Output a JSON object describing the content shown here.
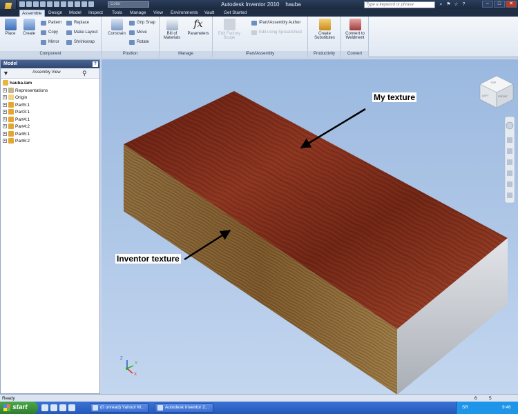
{
  "app": {
    "title": "Autodesk Inventor 2010    hauba",
    "color_box": "Color",
    "search_placeholder": "Type a keyword or phrase",
    "win_btns": [
      "–",
      "□",
      "✕"
    ],
    "top_icons": [
      "⌕",
      "⚑",
      "☆",
      "?"
    ]
  },
  "tabs": [
    "Assemble",
    "Design",
    "Model",
    "Inspect",
    "Tools",
    "Manage",
    "View",
    "Environments",
    "Vault",
    "Get Started"
  ],
  "active_tab": "Assemble",
  "ribbon": {
    "component": {
      "label": "Component",
      "place": "Place",
      "create": "Create",
      "pattern": "Pattern",
      "copy": "Copy",
      "mirror": "Mirror",
      "replace": "Replace",
      "make_layout": "Make Layout",
      "shrinkwrap": "Shrinkwrap"
    },
    "position": {
      "label": "Position",
      "constrain": "Constrain",
      "grip_snap": "Grip Snap",
      "move": "Move",
      "rotate": "Rotate"
    },
    "manage": {
      "label": "Manage",
      "bill": "Bill of Materials",
      "parameters": "Parameters"
    },
    "ipart": {
      "label": "iPart/iAssembly",
      "edit_factory": "Edit Factory Scope",
      "author": "iPart/iAssembly Author",
      "edit_sheet": "Edit using Spreadsheet"
    },
    "productivity": {
      "label": "Productivity",
      "create_sub": "Create Substitutes"
    },
    "convert": {
      "label": "Convert",
      "weldment": "Convert to Weldment"
    }
  },
  "browser": {
    "title": "Model",
    "assembly_view": "Assembly View",
    "help": "?",
    "root": "hauba.iam",
    "nodes": [
      "Representations",
      "Origin",
      "Part5:1",
      "Part3:1",
      "Part4:1",
      "Part4:2",
      "Part6:1",
      "Part6:2"
    ]
  },
  "annotations": {
    "my_texture": "My texture",
    "inventor_texture": "Inventor texture"
  },
  "viewcube": {
    "top": "TOP",
    "front": "FRONT",
    "left": "LEFT"
  },
  "triad": {
    "x": "X",
    "y": "Y",
    "z": "Z"
  },
  "status": {
    "text": "Ready",
    "n1": "6",
    "n2": "5"
  },
  "taskbar": {
    "start": "start",
    "items": [
      "(0 unread) Yahoo! M...",
      "Autodesk Inventor 2..."
    ],
    "lang": "SR",
    "clock": "9:46"
  }
}
